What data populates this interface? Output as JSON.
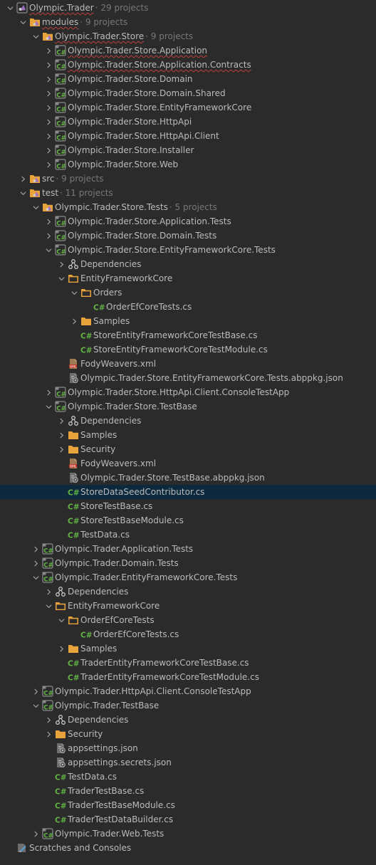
{
  "colors": {
    "background": "#2b2b2b",
    "text": "#bbbbbb",
    "meta_text": "#787878",
    "selection": "#0d293e",
    "error_underline": "#bc3f3c",
    "csharp_green": "#62b543",
    "folder_orange": "#e8a33d"
  },
  "tree": [
    {
      "depth": 0,
      "arrow": "open",
      "icon": "solution-icon",
      "label": "Olympic.Trader",
      "meta": "· 29 projects",
      "wavy": true
    },
    {
      "depth": 1,
      "arrow": "open",
      "icon": "solution-folder-icon",
      "label": "modules",
      "meta": "· 9 projects",
      "wavy": true
    },
    {
      "depth": 2,
      "arrow": "open",
      "icon": "solution-folder-icon",
      "label": "Olympic.Trader.Store",
      "meta": "· 9 projects",
      "wavy": true
    },
    {
      "depth": 3,
      "arrow": "closed",
      "icon": "csharp-project-icon",
      "label": "Olympic.Trader.Store.Application",
      "wavy": true
    },
    {
      "depth": 3,
      "arrow": "closed",
      "icon": "csharp-project-icon",
      "label": "Olympic.Trader.Store.Application.Contracts",
      "wavy": true
    },
    {
      "depth": 3,
      "arrow": "closed",
      "icon": "csharp-project-icon",
      "label": "Olympic.Trader.Store.Domain"
    },
    {
      "depth": 3,
      "arrow": "closed",
      "icon": "csharp-project-icon",
      "label": "Olympic.Trader.Store.Domain.Shared"
    },
    {
      "depth": 3,
      "arrow": "closed",
      "icon": "csharp-project-icon",
      "label": "Olympic.Trader.Store.EntityFrameworkCore"
    },
    {
      "depth": 3,
      "arrow": "closed",
      "icon": "csharp-project-icon",
      "label": "Olympic.Trader.Store.HttpApi"
    },
    {
      "depth": 3,
      "arrow": "closed",
      "icon": "csharp-project-icon",
      "label": "Olympic.Trader.Store.HttpApi.Client"
    },
    {
      "depth": 3,
      "arrow": "closed",
      "icon": "csharp-project-icon",
      "label": "Olympic.Trader.Store.Installer"
    },
    {
      "depth": 3,
      "arrow": "closed",
      "icon": "csharp-project-icon",
      "label": "Olympic.Trader.Store.Web"
    },
    {
      "depth": 1,
      "arrow": "closed",
      "icon": "solution-folder-icon",
      "label": "src",
      "meta": "· 9 projects"
    },
    {
      "depth": 1,
      "arrow": "open",
      "icon": "solution-folder-icon",
      "label": "test",
      "meta": "· 11 projects"
    },
    {
      "depth": 2,
      "arrow": "open",
      "icon": "solution-folder-icon",
      "label": "Olympic.Trader.Store.Tests",
      "meta": "· 5 projects"
    },
    {
      "depth": 3,
      "arrow": "closed",
      "icon": "csharp-project-icon",
      "label": "Olympic.Trader.Store.Application.Tests"
    },
    {
      "depth": 3,
      "arrow": "closed",
      "icon": "csharp-project-icon",
      "label": "Olympic.Trader.Store.Domain.Tests"
    },
    {
      "depth": 3,
      "arrow": "open",
      "icon": "csharp-project-icon",
      "label": "Olympic.Trader.Store.EntityFrameworkCore.Tests"
    },
    {
      "depth": 4,
      "arrow": "closed",
      "icon": "dependencies-icon",
      "label": "Dependencies"
    },
    {
      "depth": 4,
      "arrow": "open",
      "icon": "folder-open-icon",
      "label": "EntityFrameworkCore"
    },
    {
      "depth": 5,
      "arrow": "open",
      "icon": "folder-open-icon",
      "label": "Orders"
    },
    {
      "depth": 6,
      "arrow": "none",
      "icon": "csharp-file-icon",
      "label": "OrderEfCoreTests.cs"
    },
    {
      "depth": 5,
      "arrow": "closed",
      "icon": "folder-icon",
      "label": "Samples"
    },
    {
      "depth": 5,
      "arrow": "none",
      "icon": "csharp-file-icon",
      "label": "StoreEntityFrameworkCoreTestBase.cs"
    },
    {
      "depth": 5,
      "arrow": "none",
      "icon": "csharp-file-icon",
      "label": "StoreEntityFrameworkCoreTestModule.cs"
    },
    {
      "depth": 4,
      "arrow": "none",
      "icon": "xml-file-icon",
      "label": "FodyWeavers.xml"
    },
    {
      "depth": 4,
      "arrow": "none",
      "icon": "json-file-icon",
      "label": "Olympic.Trader.Store.EntityFrameworkCore.Tests.abppkg.json"
    },
    {
      "depth": 3,
      "arrow": "closed",
      "icon": "csharp-project-icon",
      "label": "Olympic.Trader.Store.HttpApi.Client.ConsoleTestApp"
    },
    {
      "depth": 3,
      "arrow": "open",
      "icon": "csharp-project-icon",
      "label": "Olympic.Trader.Store.TestBase"
    },
    {
      "depth": 4,
      "arrow": "closed",
      "icon": "dependencies-icon",
      "label": "Dependencies"
    },
    {
      "depth": 4,
      "arrow": "closed",
      "icon": "folder-icon",
      "label": "Samples"
    },
    {
      "depth": 4,
      "arrow": "closed",
      "icon": "folder-icon",
      "label": "Security"
    },
    {
      "depth": 4,
      "arrow": "none",
      "icon": "xml-file-icon",
      "label": "FodyWeavers.xml"
    },
    {
      "depth": 4,
      "arrow": "none",
      "icon": "json-file-icon",
      "label": "Olympic.Trader.Store.TestBase.abppkg.json"
    },
    {
      "depth": 4,
      "arrow": "none",
      "icon": "csharp-file-icon",
      "label": "StoreDataSeedContributor.cs",
      "selected": true
    },
    {
      "depth": 4,
      "arrow": "none",
      "icon": "csharp-file-icon",
      "label": "StoreTestBase.cs"
    },
    {
      "depth": 4,
      "arrow": "none",
      "icon": "csharp-file-icon",
      "label": "StoreTestBaseModule.cs"
    },
    {
      "depth": 4,
      "arrow": "none",
      "icon": "csharp-file-icon",
      "label": "TestData.cs"
    },
    {
      "depth": 2,
      "arrow": "closed",
      "icon": "csharp-project-icon",
      "label": "Olympic.Trader.Application.Tests"
    },
    {
      "depth": 2,
      "arrow": "closed",
      "icon": "csharp-project-icon",
      "label": "Olympic.Trader.Domain.Tests"
    },
    {
      "depth": 2,
      "arrow": "open",
      "icon": "csharp-project-icon",
      "label": "Olympic.Trader.EntityFrameworkCore.Tests"
    },
    {
      "depth": 3,
      "arrow": "closed",
      "icon": "dependencies-icon",
      "label": "Dependencies"
    },
    {
      "depth": 3,
      "arrow": "open",
      "icon": "folder-open-icon",
      "label": "EntityFrameworkCore"
    },
    {
      "depth": 4,
      "arrow": "open",
      "icon": "folder-open-icon",
      "label": "OrderEfCoreTests"
    },
    {
      "depth": 5,
      "arrow": "none",
      "icon": "csharp-file-icon",
      "label": "OrderEfCoreTests.cs"
    },
    {
      "depth": 4,
      "arrow": "closed",
      "icon": "folder-icon",
      "label": "Samples"
    },
    {
      "depth": 4,
      "arrow": "none",
      "icon": "csharp-file-icon",
      "label": "TraderEntityFrameworkCoreTestBase.cs"
    },
    {
      "depth": 4,
      "arrow": "none",
      "icon": "csharp-file-icon",
      "label": "TraderEntityFrameworkCoreTestModule.cs"
    },
    {
      "depth": 2,
      "arrow": "closed",
      "icon": "csharp-project-icon",
      "label": "Olympic.Trader.HttpApi.Client.ConsoleTestApp"
    },
    {
      "depth": 2,
      "arrow": "open",
      "icon": "csharp-project-icon",
      "label": "Olympic.Trader.TestBase"
    },
    {
      "depth": 3,
      "arrow": "closed",
      "icon": "dependencies-icon",
      "label": "Dependencies"
    },
    {
      "depth": 3,
      "arrow": "closed",
      "icon": "folder-icon",
      "label": "Security"
    },
    {
      "depth": 3,
      "arrow": "none",
      "icon": "json-file-icon",
      "label": "appsettings.json"
    },
    {
      "depth": 3,
      "arrow": "none",
      "icon": "json-file-icon",
      "label": "appsettings.secrets.json"
    },
    {
      "depth": 3,
      "arrow": "none",
      "icon": "csharp-file-icon",
      "label": "TestData.cs"
    },
    {
      "depth": 3,
      "arrow": "none",
      "icon": "csharp-file-icon",
      "label": "TraderTestBase.cs"
    },
    {
      "depth": 3,
      "arrow": "none",
      "icon": "csharp-file-icon",
      "label": "TraderTestBaseModule.cs"
    },
    {
      "depth": 3,
      "arrow": "none",
      "icon": "csharp-file-icon",
      "label": "TraderTestDataBuilder.cs"
    },
    {
      "depth": 2,
      "arrow": "closed",
      "icon": "csharp-project-icon",
      "label": "Olympic.Trader.Web.Tests"
    },
    {
      "depth": 0,
      "arrow": "none",
      "icon": "scratches-icon",
      "label": "Scratches and Consoles"
    }
  ]
}
